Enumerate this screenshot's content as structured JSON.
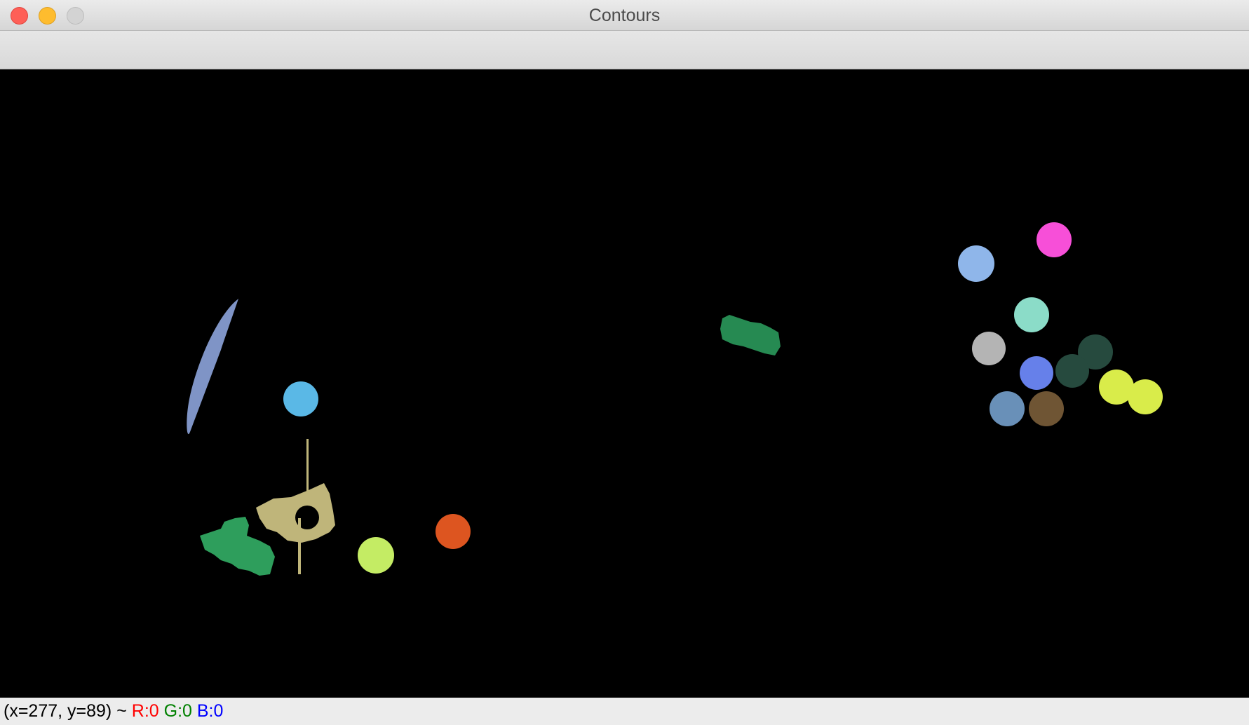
{
  "window": {
    "title": "Contours"
  },
  "status": {
    "coords": "(x=277, y=89) ~ ",
    "r_label": "R:0",
    "g_label": "G:0",
    "b_label": "B:0",
    "r_color": "#ff0000",
    "g_color": "#008000",
    "b_color": "#0000ff"
  },
  "canvas": {
    "background": "#000000",
    "blob_colors": {
      "sky_blue": "#5ab8e6",
      "orange": "#dd5520",
      "lime": "#c4ec64",
      "khaki": "#bfb57a",
      "green": "#2e9e5c",
      "slate_blue": "#7f94c6",
      "dark_green": "#268a52",
      "magenta": "#f74fd8",
      "light_blue": "#8fb6ea",
      "aqua": "#8bdcc8",
      "gray": "#b4b4b4",
      "dark_slate": "#264a3e",
      "royal_blue": "#6680ea",
      "steel_blue": "#6990b8",
      "brown": "#6f5534",
      "yellow": "#d9ec4a"
    }
  }
}
